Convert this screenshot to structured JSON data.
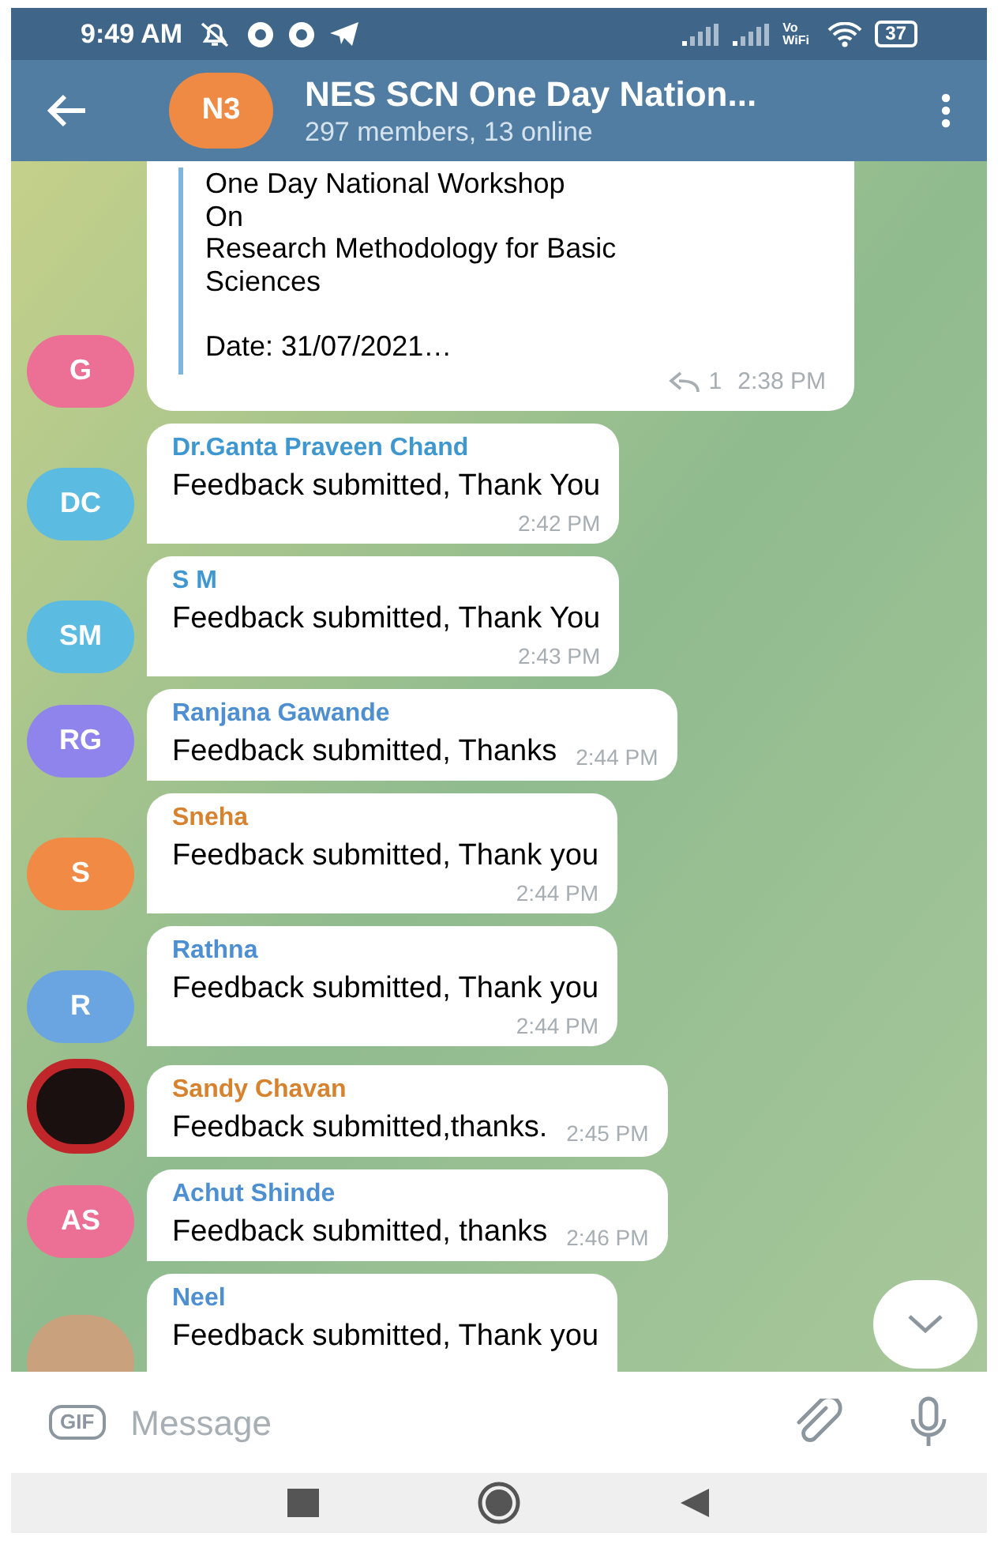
{
  "status_bar": {
    "time": "9:49 AM",
    "wifi_label": "Vo WiFi",
    "battery": "37"
  },
  "header": {
    "avatar": {
      "initials": "N3",
      "color": "#ef8a44"
    },
    "title": "NES SCN One Day Nation...",
    "subtitle": "297 members, 13 online"
  },
  "messages": [
    {
      "kind": "forwarded",
      "avatar": {
        "initials": "G",
        "color": "#ec6f96"
      },
      "paragraphs": [
        [
          "One Day National Workshop",
          "On",
          "Research Methodology for Basic",
          "Sciences"
        ],
        [
          "Date: 31/07/2021…"
        ]
      ],
      "replies": "1",
      "time": "2:38 PM"
    },
    {
      "kind": "stacked",
      "avatar": {
        "initials": "DC",
        "color": "#5bbbe0"
      },
      "sender": "Dr.Ganta Praveen Chand",
      "color": "#3f97d0",
      "text": "Feedback submitted, Thank You",
      "time": "2:42 PM"
    },
    {
      "kind": "stacked",
      "avatar": {
        "initials": "SM",
        "color": "#5bbbe0"
      },
      "sender": "S M",
      "color": "#3f97d0",
      "text": "Feedback submitted, Thank You",
      "time": "2:43 PM"
    },
    {
      "kind": "inline",
      "avatar": {
        "initials": "RG",
        "color": "#8f84ec"
      },
      "sender": "Ranjana Gawande",
      "color": "#4d8fd0",
      "text": "Feedback submitted, Thanks",
      "time": "2:44 PM"
    },
    {
      "kind": "stacked",
      "avatar": {
        "initials": "S",
        "color": "#f08a45"
      },
      "sender": "Sneha",
      "color": "#d6822e",
      "text": "Feedback submitted, Thank you",
      "time": "2:44 PM"
    },
    {
      "kind": "stacked",
      "avatar": {
        "initials": "R",
        "color": "#6aa5e2"
      },
      "sender": "Rathna",
      "color": "#4d8fd0",
      "text": "Feedback submitted, Thank you",
      "time": "2:44 PM"
    },
    {
      "kind": "inline",
      "avatar": {
        "kind": "badge"
      },
      "sender": "Sandy Chavan",
      "color": "#d6822e",
      "text": "Feedback submitted,thanks.",
      "time": "2:45 PM"
    },
    {
      "kind": "inline",
      "avatar": {
        "initials": "AS",
        "color": "#ec6f96"
      },
      "sender": "Achut Shinde",
      "color": "#4d8fd0",
      "text": "Feedback submitted, thanks",
      "time": "2:46 PM"
    },
    {
      "kind": "cut",
      "avatar": {
        "kind": "photo"
      },
      "sender": "Neel",
      "color": "#4d8fd0",
      "text": "Feedback submitted, Thank you"
    }
  ],
  "composer": {
    "gif_label": "GIF",
    "placeholder": "Message"
  }
}
